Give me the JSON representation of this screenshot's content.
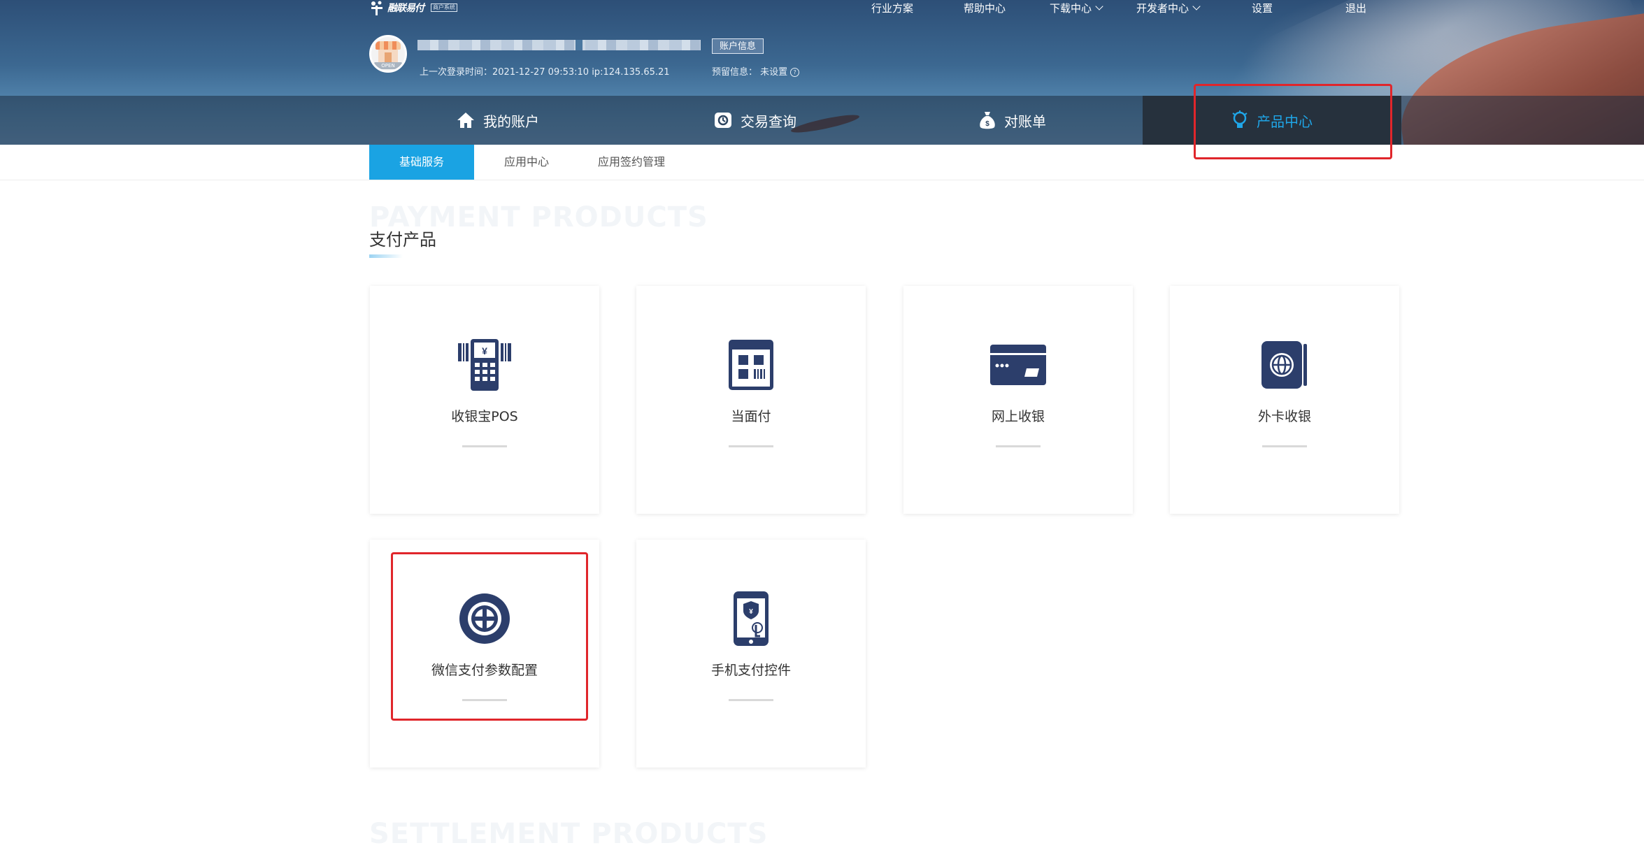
{
  "header": {
    "logo_text": "融联易付",
    "logo_sub": "商户系统",
    "top_links": [
      {
        "label": "行业方案",
        "has_dropdown": false
      },
      {
        "label": "帮助中心",
        "has_dropdown": false
      },
      {
        "label": "下载中心",
        "has_dropdown": true
      },
      {
        "label": "开发者中心",
        "has_dropdown": true
      },
      {
        "label": "设置",
        "has_dropdown": false
      },
      {
        "label": "退出",
        "has_dropdown": false
      }
    ],
    "account_button": "账户信息",
    "last_login": "上一次登录时间：2021-12-27 09:53:10 ip:124.135.65.21",
    "reserve_info": "预留信息：  未设置",
    "avatar_sign": "OPEN"
  },
  "main_nav": [
    {
      "label": "我的账户",
      "icon": "home-icon",
      "active": false
    },
    {
      "label": "交易查询",
      "icon": "query-icon",
      "active": false
    },
    {
      "label": "对账单",
      "icon": "money-bag-icon",
      "active": false
    },
    {
      "label": "产品中心",
      "icon": "lightbulb-icon",
      "active": true
    }
  ],
  "sub_tabs": [
    {
      "label": "基础服务",
      "active": true
    },
    {
      "label": "应用中心",
      "active": false
    },
    {
      "label": "应用签约管理",
      "active": false
    }
  ],
  "section": {
    "ghost_title": "PAYMENT PRODUCTS",
    "title": "支付产品",
    "ghost_title_next": "SETTLEMENT PRODUCTS"
  },
  "products": [
    {
      "label": "收银宝POS",
      "icon": "pos-terminal-icon"
    },
    {
      "label": "当面付",
      "icon": "qr-code-icon"
    },
    {
      "label": "网上收银",
      "icon": "bank-card-icon"
    },
    {
      "label": "外卡收银",
      "icon": "globe-card-icon"
    },
    {
      "label": "微信支付参数配置",
      "icon": "target-icon"
    },
    {
      "label": "手机支付控件",
      "icon": "mobile-pay-icon"
    }
  ],
  "colors": {
    "accent": "#1aa3e3",
    "icon_navy": "#2c3e6b",
    "annotation_red": "#e0262b"
  }
}
